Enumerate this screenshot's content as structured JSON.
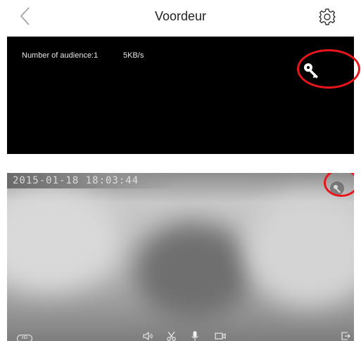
{
  "header": {
    "title": "Voordeur",
    "back_icon": "chevron-left-icon",
    "settings_icon": "gear-icon"
  },
  "live_view": {
    "audience_text": "Number of audience:1",
    "bitrate_text": "5KB/s",
    "key_icon": "key-icon"
  },
  "playback_view": {
    "timestamp_text": "2015-01-18 18:03:44",
    "hd_label": "HD",
    "controls": [
      "speaker-icon",
      "scissors-icon",
      "microphone-icon",
      "video-record-icon",
      "exit-fullscreen-icon"
    ]
  },
  "colors": {
    "highlight": "#e8161b",
    "panel_background": "#000000",
    "header_background": "#ffffff"
  }
}
